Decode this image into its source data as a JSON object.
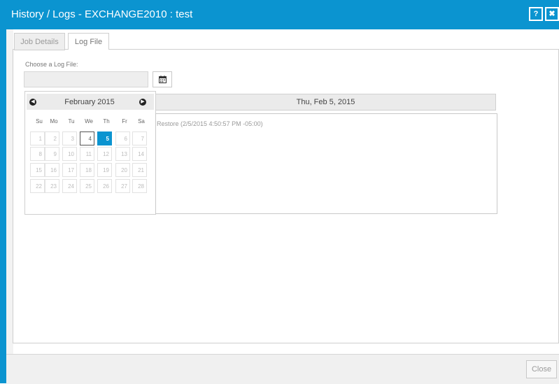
{
  "window": {
    "title": "History / Logs - EXCHANGE2010 : test",
    "help_label": "?",
    "close_label": "✖"
  },
  "tabs": [
    {
      "label": "Job Details",
      "active": false
    },
    {
      "label": "Log File",
      "active": true
    }
  ],
  "log_file": {
    "choose_label": "Choose a Log File:",
    "value": ""
  },
  "calendar": {
    "month_label": "February 2015",
    "weekdays": [
      "Su",
      "Mo",
      "Tu",
      "We",
      "Th",
      "Fr",
      "Sa"
    ],
    "weeks": [
      [
        "1",
        "2",
        "3",
        "4",
        "5",
        "6",
        "7"
      ],
      [
        "8",
        "9",
        "10",
        "11",
        "12",
        "13",
        "14"
      ],
      [
        "15",
        "16",
        "17",
        "18",
        "19",
        "20",
        "21"
      ],
      [
        "22",
        "23",
        "24",
        "25",
        "26",
        "27",
        "28"
      ]
    ],
    "enabled_days": [
      "4",
      "5"
    ],
    "selected_day": "5"
  },
  "log_panel": {
    "date_header": "Thu, Feb 5, 2015",
    "entries": [
      "Restore (2/5/2015 4:50:57 PM -05:00)"
    ]
  },
  "footer": {
    "close_button": "Close"
  },
  "colors": {
    "accent": "#0b94d0"
  }
}
